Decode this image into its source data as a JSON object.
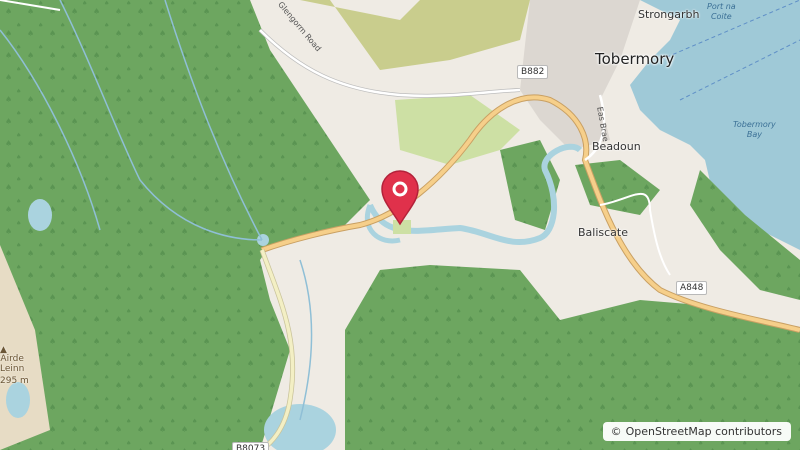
{
  "map": {
    "attribution_symbol": "©",
    "attribution": "OpenStreetMap contributors",
    "colors": {
      "land": "#efebe4",
      "forest": "#6da660",
      "water": "#aad3df",
      "sea": "#9fc9d7",
      "main_road": "#f6cf8a",
      "minor_road": "#ffffff",
      "marker": "#e0314b"
    },
    "labels": {
      "town_tobermory": "Tobermory",
      "place_strongarbh": "Strongarbh",
      "place_beadoun": "Beadoun",
      "place_baliscate": "Baliscate",
      "bay": "Tobermory\nBay",
      "port": "Port na\nCoite",
      "road_b882": "B882",
      "road_a848": "A848",
      "road_b8073": "B8073",
      "road_glengorm": "Glengorm Road",
      "road_eas_brae": "Eas Brae",
      "peak_name": "Airde\nLeinn",
      "peak_elev": "295 m"
    },
    "marker_icon": "map-pin-icon"
  }
}
